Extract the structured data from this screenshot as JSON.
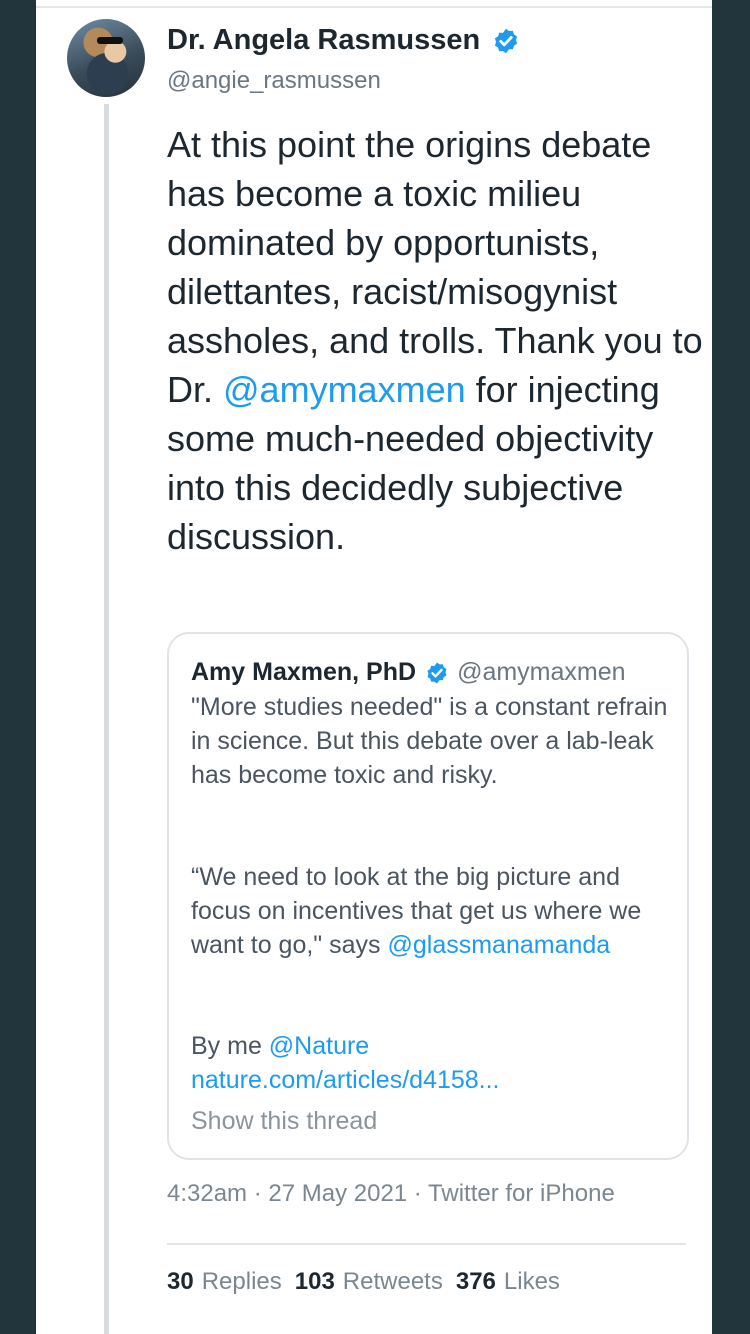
{
  "tweet": {
    "author_name": "Dr. Angela Rasmussen",
    "author_handle": "@angie_rasmussen",
    "text_part1": "At this point the origins debate has become a toxic milieu dominated by opportunists, dilettantes, racist/misogynist assholes, and trolls. Thank you to Dr. ",
    "mention": "@amymaxmen",
    "text_part2": " for injecting some much-needed objectivity into this decidedly subjective discussion.",
    "timestamp": "4:32am · 27 May 2021 · Twitter for iPhone"
  },
  "quoted_tweet": {
    "author_name": "Amy Maxmen, PhD",
    "author_handle": "@amymaxmen",
    "para1": "\"More studies needed\" is a constant refrain in science. But this debate over a lab-leak has become toxic and risky.",
    "para2_text": "“We need to look at the big picture and focus on incentives that get us where we want to go,\" says ",
    "para2_mention": "@glassmanamanda",
    "by_me": "By me ",
    "nature_mention": "@Nature",
    "article_link": "nature.com/articles/d4158...",
    "show_thread": "Show this thread"
  },
  "stats": {
    "replies_count": "30",
    "replies_label": "Replies",
    "retweets_count": "103",
    "retweets_label": "Retweets",
    "likes_count": "376",
    "likes_label": "Likes"
  },
  "colors": {
    "accent": "#1d9bf0",
    "background": "#22343c"
  },
  "icons": [
    "verified-badge-icon"
  ]
}
